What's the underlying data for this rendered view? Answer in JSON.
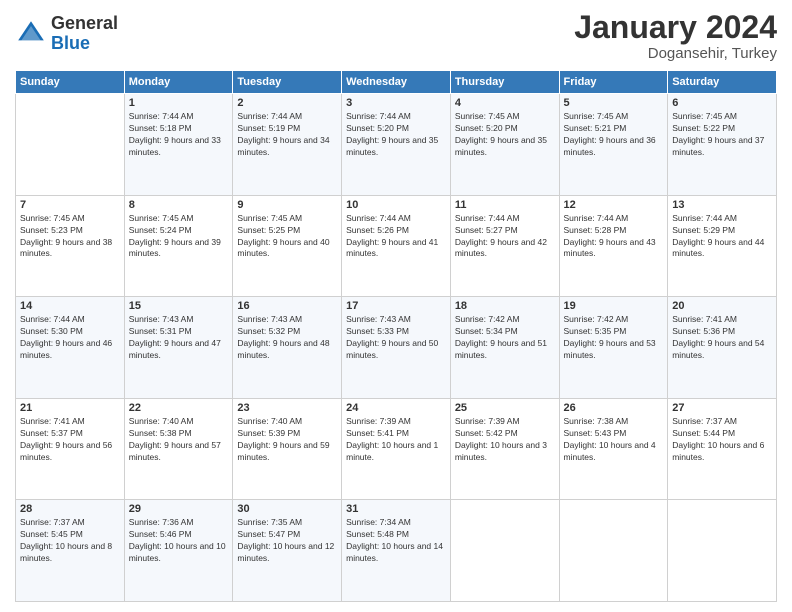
{
  "logo": {
    "general": "General",
    "blue": "Blue"
  },
  "title": "January 2024",
  "location": "Dogansehir, Turkey",
  "headers": [
    "Sunday",
    "Monday",
    "Tuesday",
    "Wednesday",
    "Thursday",
    "Friday",
    "Saturday"
  ],
  "weeks": [
    [
      {
        "day": "",
        "sunrise": "",
        "sunset": "",
        "daylight": ""
      },
      {
        "day": "1",
        "sunrise": "Sunrise: 7:44 AM",
        "sunset": "Sunset: 5:18 PM",
        "daylight": "Daylight: 9 hours and 33 minutes."
      },
      {
        "day": "2",
        "sunrise": "Sunrise: 7:44 AM",
        "sunset": "Sunset: 5:19 PM",
        "daylight": "Daylight: 9 hours and 34 minutes."
      },
      {
        "day": "3",
        "sunrise": "Sunrise: 7:44 AM",
        "sunset": "Sunset: 5:20 PM",
        "daylight": "Daylight: 9 hours and 35 minutes."
      },
      {
        "day": "4",
        "sunrise": "Sunrise: 7:45 AM",
        "sunset": "Sunset: 5:20 PM",
        "daylight": "Daylight: 9 hours and 35 minutes."
      },
      {
        "day": "5",
        "sunrise": "Sunrise: 7:45 AM",
        "sunset": "Sunset: 5:21 PM",
        "daylight": "Daylight: 9 hours and 36 minutes."
      },
      {
        "day": "6",
        "sunrise": "Sunrise: 7:45 AM",
        "sunset": "Sunset: 5:22 PM",
        "daylight": "Daylight: 9 hours and 37 minutes."
      }
    ],
    [
      {
        "day": "7",
        "sunrise": "Sunrise: 7:45 AM",
        "sunset": "Sunset: 5:23 PM",
        "daylight": "Daylight: 9 hours and 38 minutes."
      },
      {
        "day": "8",
        "sunrise": "Sunrise: 7:45 AM",
        "sunset": "Sunset: 5:24 PM",
        "daylight": "Daylight: 9 hours and 39 minutes."
      },
      {
        "day": "9",
        "sunrise": "Sunrise: 7:45 AM",
        "sunset": "Sunset: 5:25 PM",
        "daylight": "Daylight: 9 hours and 40 minutes."
      },
      {
        "day": "10",
        "sunrise": "Sunrise: 7:44 AM",
        "sunset": "Sunset: 5:26 PM",
        "daylight": "Daylight: 9 hours and 41 minutes."
      },
      {
        "day": "11",
        "sunrise": "Sunrise: 7:44 AM",
        "sunset": "Sunset: 5:27 PM",
        "daylight": "Daylight: 9 hours and 42 minutes."
      },
      {
        "day": "12",
        "sunrise": "Sunrise: 7:44 AM",
        "sunset": "Sunset: 5:28 PM",
        "daylight": "Daylight: 9 hours and 43 minutes."
      },
      {
        "day": "13",
        "sunrise": "Sunrise: 7:44 AM",
        "sunset": "Sunset: 5:29 PM",
        "daylight": "Daylight: 9 hours and 44 minutes."
      }
    ],
    [
      {
        "day": "14",
        "sunrise": "Sunrise: 7:44 AM",
        "sunset": "Sunset: 5:30 PM",
        "daylight": "Daylight: 9 hours and 46 minutes."
      },
      {
        "day": "15",
        "sunrise": "Sunrise: 7:43 AM",
        "sunset": "Sunset: 5:31 PM",
        "daylight": "Daylight: 9 hours and 47 minutes."
      },
      {
        "day": "16",
        "sunrise": "Sunrise: 7:43 AM",
        "sunset": "Sunset: 5:32 PM",
        "daylight": "Daylight: 9 hours and 48 minutes."
      },
      {
        "day": "17",
        "sunrise": "Sunrise: 7:43 AM",
        "sunset": "Sunset: 5:33 PM",
        "daylight": "Daylight: 9 hours and 50 minutes."
      },
      {
        "day": "18",
        "sunrise": "Sunrise: 7:42 AM",
        "sunset": "Sunset: 5:34 PM",
        "daylight": "Daylight: 9 hours and 51 minutes."
      },
      {
        "day": "19",
        "sunrise": "Sunrise: 7:42 AM",
        "sunset": "Sunset: 5:35 PM",
        "daylight": "Daylight: 9 hours and 53 minutes."
      },
      {
        "day": "20",
        "sunrise": "Sunrise: 7:41 AM",
        "sunset": "Sunset: 5:36 PM",
        "daylight": "Daylight: 9 hours and 54 minutes."
      }
    ],
    [
      {
        "day": "21",
        "sunrise": "Sunrise: 7:41 AM",
        "sunset": "Sunset: 5:37 PM",
        "daylight": "Daylight: 9 hours and 56 minutes."
      },
      {
        "day": "22",
        "sunrise": "Sunrise: 7:40 AM",
        "sunset": "Sunset: 5:38 PM",
        "daylight": "Daylight: 9 hours and 57 minutes."
      },
      {
        "day": "23",
        "sunrise": "Sunrise: 7:40 AM",
        "sunset": "Sunset: 5:39 PM",
        "daylight": "Daylight: 9 hours and 59 minutes."
      },
      {
        "day": "24",
        "sunrise": "Sunrise: 7:39 AM",
        "sunset": "Sunset: 5:41 PM",
        "daylight": "Daylight: 10 hours and 1 minute."
      },
      {
        "day": "25",
        "sunrise": "Sunrise: 7:39 AM",
        "sunset": "Sunset: 5:42 PM",
        "daylight": "Daylight: 10 hours and 3 minutes."
      },
      {
        "day": "26",
        "sunrise": "Sunrise: 7:38 AM",
        "sunset": "Sunset: 5:43 PM",
        "daylight": "Daylight: 10 hours and 4 minutes."
      },
      {
        "day": "27",
        "sunrise": "Sunrise: 7:37 AM",
        "sunset": "Sunset: 5:44 PM",
        "daylight": "Daylight: 10 hours and 6 minutes."
      }
    ],
    [
      {
        "day": "28",
        "sunrise": "Sunrise: 7:37 AM",
        "sunset": "Sunset: 5:45 PM",
        "daylight": "Daylight: 10 hours and 8 minutes."
      },
      {
        "day": "29",
        "sunrise": "Sunrise: 7:36 AM",
        "sunset": "Sunset: 5:46 PM",
        "daylight": "Daylight: 10 hours and 10 minutes."
      },
      {
        "day": "30",
        "sunrise": "Sunrise: 7:35 AM",
        "sunset": "Sunset: 5:47 PM",
        "daylight": "Daylight: 10 hours and 12 minutes."
      },
      {
        "day": "31",
        "sunrise": "Sunrise: 7:34 AM",
        "sunset": "Sunset: 5:48 PM",
        "daylight": "Daylight: 10 hours and 14 minutes."
      },
      {
        "day": "",
        "sunrise": "",
        "sunset": "",
        "daylight": ""
      },
      {
        "day": "",
        "sunrise": "",
        "sunset": "",
        "daylight": ""
      },
      {
        "day": "",
        "sunrise": "",
        "sunset": "",
        "daylight": ""
      }
    ]
  ]
}
